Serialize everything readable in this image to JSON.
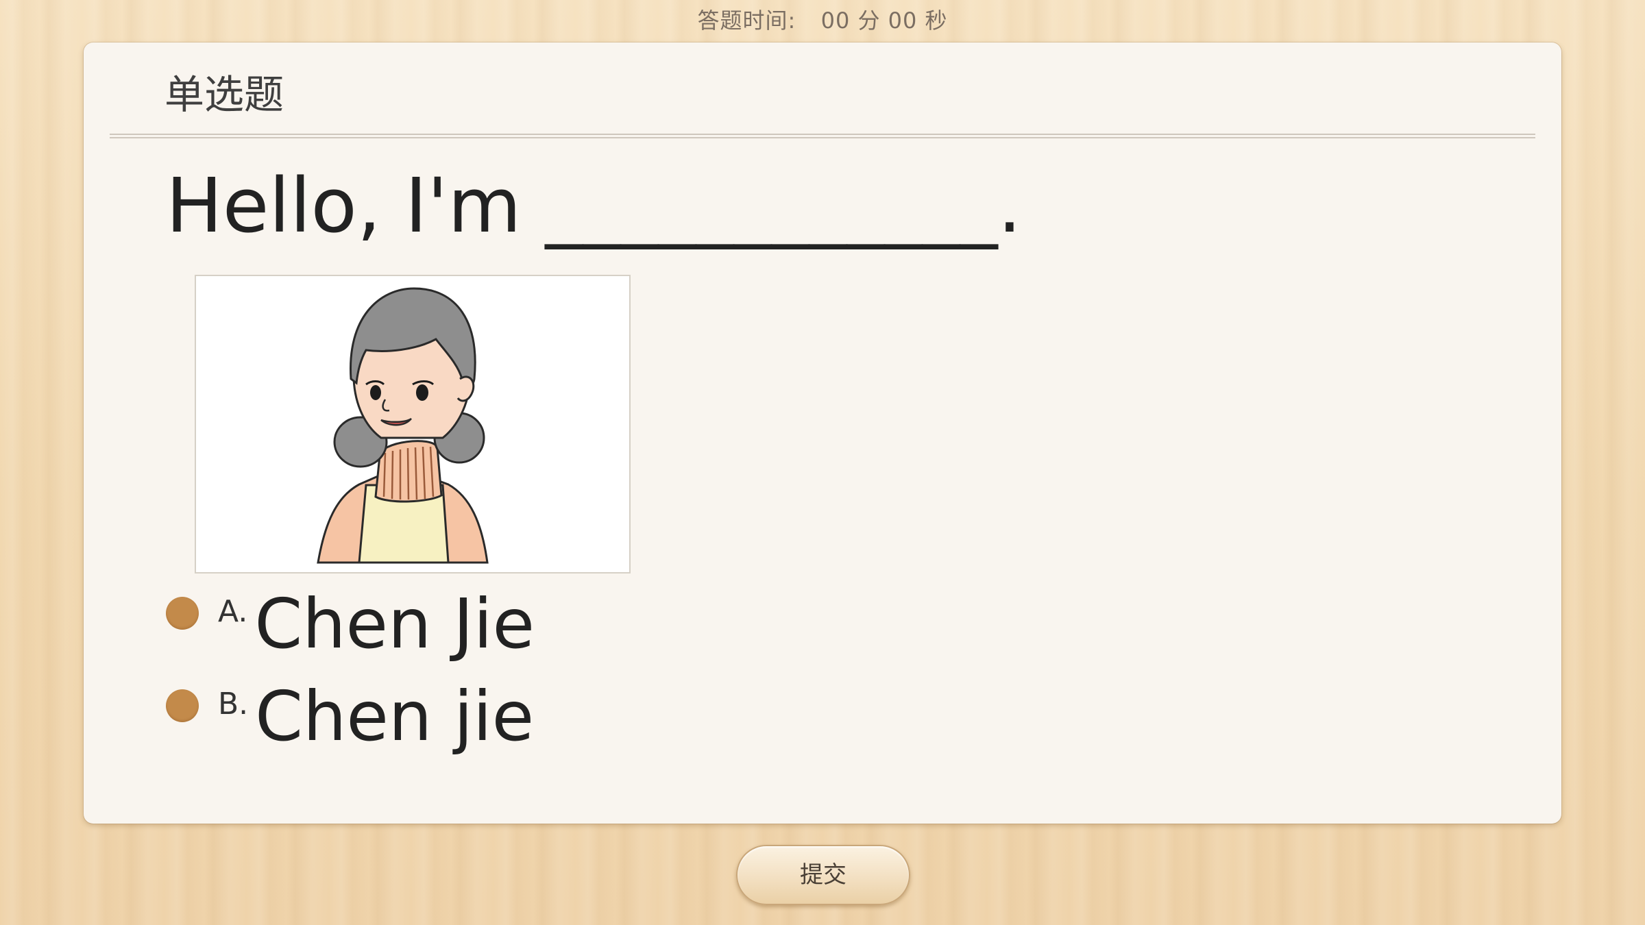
{
  "timer": {
    "label": "答题时间:",
    "minutes": "00",
    "minutes_unit": "分",
    "seconds": "00",
    "seconds_unit": "秒"
  },
  "question": {
    "type_label": "单选题",
    "prompt": "Hello, I'm ____________."
  },
  "options": [
    {
      "letter": "A.",
      "text": "Chen Jie"
    },
    {
      "letter": "B.",
      "text": "Chen jie"
    }
  ],
  "submit_label": "提交",
  "colors": {
    "radio": "#c38a4a",
    "card": "#f9f5ef",
    "background": "#f3dcb6"
  }
}
